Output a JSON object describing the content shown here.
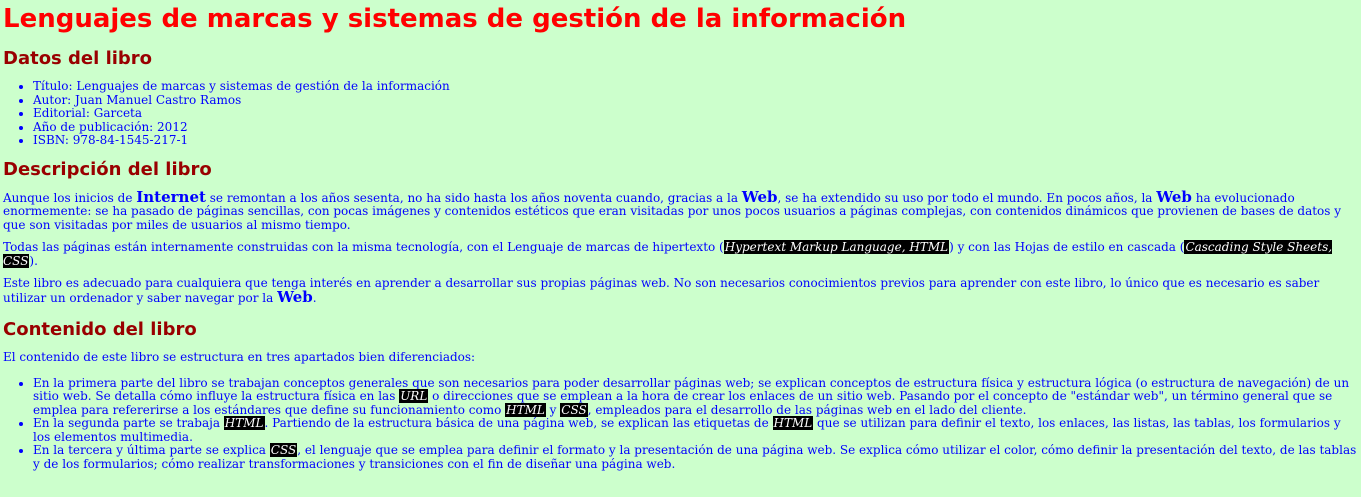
{
  "title": "Lenguajes de marcas y sistemas de gestión de la información",
  "datos": {
    "heading": "Datos del libro",
    "items": [
      "Título: Lenguajes de marcas y sistemas de gestión de la información",
      "Autor: Juan Manuel Castro Ramos",
      "Editorial: Garceta",
      "Año de publicación: 2012",
      "ISBN: 978-84-1545-217-1"
    ]
  },
  "descripcion": {
    "heading": "Descripción del libro",
    "p1": [
      "Aunque los inicios de ",
      "Internet",
      " se remontan a los años sesenta, no ha sido hasta los años noventa cuando, gracias a la ",
      "Web",
      ", se ha extendido su uso por todo el mundo. En pocos años, la ",
      "Web",
      " ha evolucionado enormemente: se ha pasado de páginas sencillas, con pocas imágenes y contenidos estéticos que eran visitadas por unos pocos usuarios a páginas complejas, con contenidos dinámicos que provienen de bases de datos y que son visitadas por miles de usuarios al mismo tiempo."
    ],
    "p2": [
      "Todas las páginas están internamente construidas con la misma tecnología, con el Lenguaje de marcas de hipertexto (",
      "Hypertext Markup Language, HTML",
      ") y con las Hojas de estilo en cascada (",
      "Cascading Style Sheets, CSS",
      ")."
    ],
    "p3": [
      "Este libro es adecuado para cualquiera que tenga interés en aprender a desarrollar sus propias páginas web. No son necesarios conocimientos previos para aprender con este libro, lo único que es necesario es saber utilizar un ordenador y saber navegar por la ",
      "Web",
      "."
    ]
  },
  "contenido": {
    "heading": "Contenido del libro",
    "intro": "El contenido de este libro se estructura en tres apartados bien diferenciados:",
    "li1": [
      "En la primera parte del libro se trabajan conceptos generales que son necesarios para poder desarrollar páginas web; se explican conceptos de estructura física y estructura lógica (o estructura de navegación) de un sitio web. Se detalla cómo influye la estructura física en las ",
      "URL",
      " o direcciones que se emplean a la hora de crear los enlaces de un sitio web. Pasando por el concepto de \"estándar web\", un término general que se emplea para refererirse a los estándares que define su funcionamiento como ",
      "HTML",
      " y ",
      "CSS",
      ", empleados para el desarrollo de las páginas web en el lado del cliente."
    ],
    "li2": [
      "En la segunda parte se trabaja ",
      "HTML",
      ". Partiendo de la estructura básica de una página web, se explican las etiquetas de ",
      "HTML",
      " que se utilizan para definir el texto, los enlaces, las listas, las tablas, los formularios y los elementos multimedia."
    ],
    "li3": [
      "En la tercera y última parte se explica ",
      "CSS",
      ", el lenguaje que se emplea para definir el formato y la presentación de una página web. Se explica cómo utilizar el color, cómo definir la presentación del texto, de las tablas y de los formularios; cómo realizar transformaciones y transiciones con el fin de diseñar una página web."
    ]
  }
}
